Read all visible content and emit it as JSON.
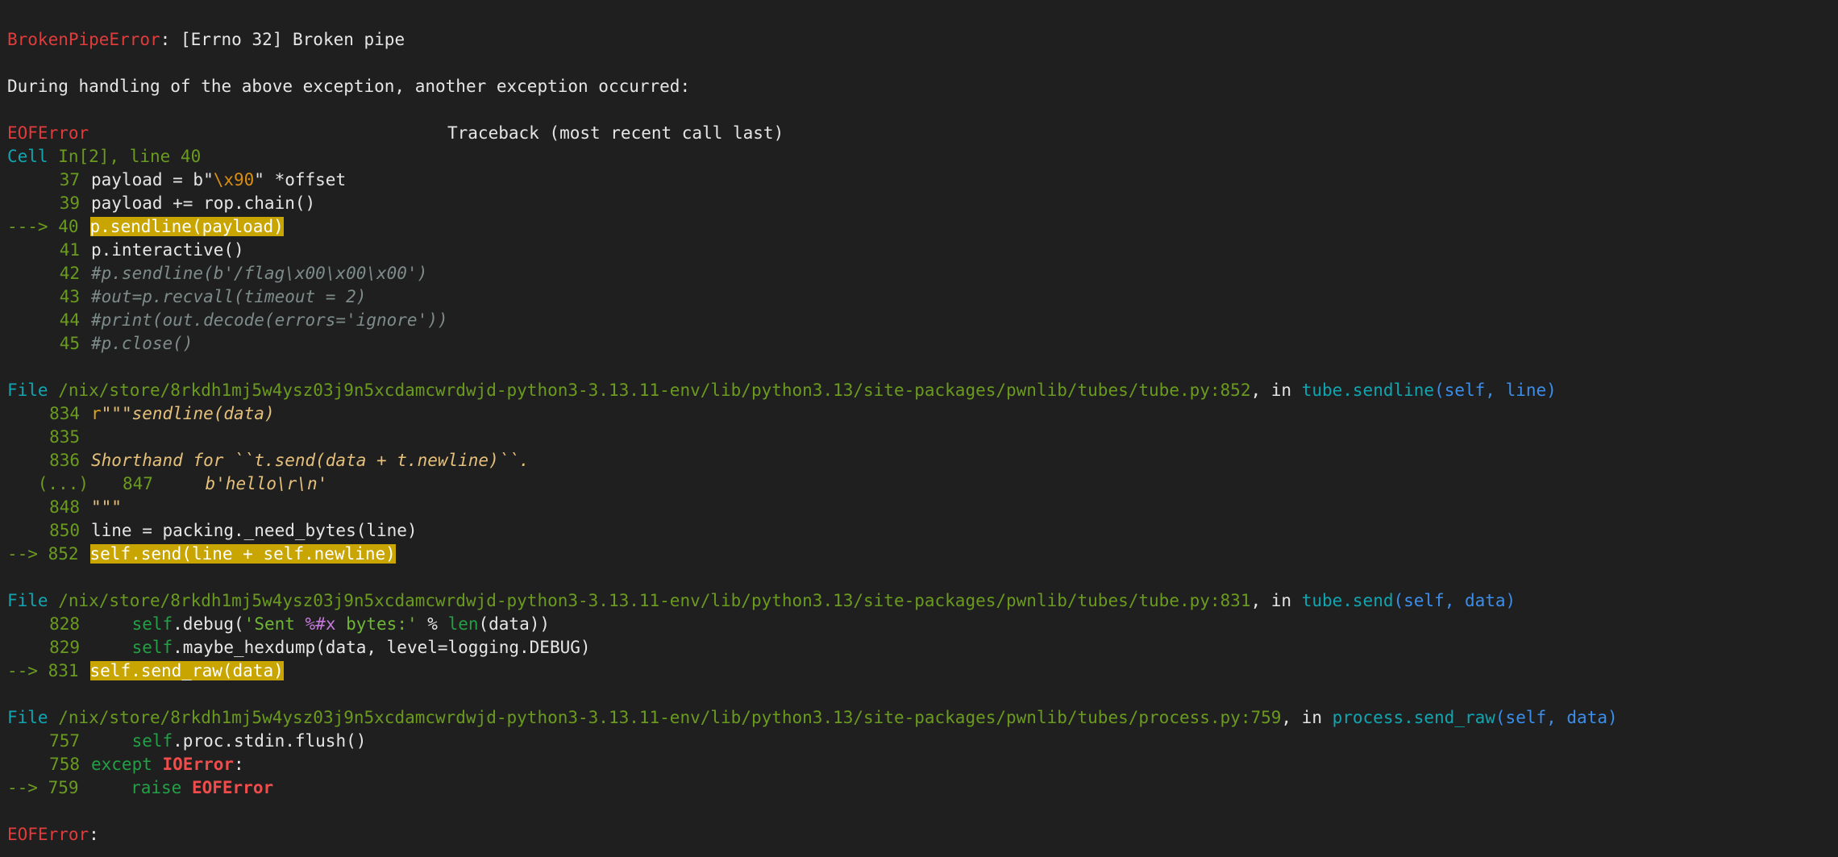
{
  "error1": {
    "name": "BrokenPipeError",
    "message": ": [Errno 32] Broken pipe"
  },
  "during_msg": "During handling of the above exception, another exception occurred:",
  "error2": {
    "name": "EOFError",
    "traceback": "Traceback (most recent call last)"
  },
  "cell": {
    "header": "Cell In[2], line 40",
    "lines": [
      {
        "no": "37",
        "marker": "",
        "text_a": "payload = b\"",
        "text_b": "\\x90",
        "text_c": "\" *offset"
      },
      {
        "no": "39",
        "marker": "",
        "text": "payload += rop.chain()"
      },
      {
        "no": "40",
        "marker": "---> ",
        "text": "p.sendline(payload)"
      },
      {
        "no": "41",
        "marker": "",
        "text": "p.interactive()"
      },
      {
        "no": "42",
        "marker": "",
        "text": "#p.sendline(b'/flag\\x00\\x00\\x00')"
      },
      {
        "no": "43",
        "marker": "",
        "text": "#out=p.recvall(timeout = 2)"
      },
      {
        "no": "44",
        "marker": "",
        "text": "#print(out.decode(errors='ignore'))"
      },
      {
        "no": "45",
        "marker": "",
        "text": "#p.close()"
      }
    ]
  },
  "frame1": {
    "file_label": "File ",
    "path": "/nix/store/8rkdh1mj5w4ysz03j9n5xcdamcwrdwjd-python3-3.13.11-env/lib/python3.13/site-packages/pwnlib/tubes/tube.py:852",
    "in_label": ", in ",
    "func": "tube.sendline",
    "args": "(self, line)",
    "lines": [
      {
        "no": "834",
        "text_a": "r",
        "text_b": "\"\"\"sendline(data)"
      },
      {
        "no": "835",
        "text": ""
      },
      {
        "no": "836",
        "text": "Shorthand for ``t.send(data + t.newline)``."
      },
      {
        "ellipsis": "(...)",
        "no": "847",
        "text": "    b'hello\\r\\n'"
      },
      {
        "no": "848",
        "text": "\"\"\""
      },
      {
        "no": "850",
        "text": "line = packing._need_bytes(line)"
      },
      {
        "no": "852",
        "marker": "--> ",
        "text": "self.send(line + self.newline)"
      }
    ]
  },
  "frame2": {
    "file_label": "File ",
    "path": "/nix/store/8rkdh1mj5w4ysz03j9n5xcdamcwrdwjd-python3-3.13.11-env/lib/python3.13/site-packages/pwnlib/tubes/tube.py:831",
    "in_label": ", in ",
    "func": "tube.send",
    "args": "(self, data)",
    "lines": [
      {
        "no": "828",
        "self": "self",
        "t1": ".debug(",
        "str": "'Sent ",
        "fmt": "%#x",
        "str2": " bytes:'",
        "t2": " % ",
        "builtin": "len",
        "t3": "(data))"
      },
      {
        "no": "829",
        "self": "self",
        "t1": ".maybe_hexdump(data, level=logging.DEBUG)"
      },
      {
        "no": "831",
        "marker": "--> ",
        "text": "self.send_raw(data)"
      }
    ]
  },
  "frame3": {
    "file_label": "File ",
    "path": "/nix/store/8rkdh1mj5w4ysz03j9n5xcdamcwrdwjd-python3-3.13.11-env/lib/python3.13/site-packages/pwnlib/tubes/process.py:759",
    "in_label": ", in ",
    "func": "process.send_raw",
    "args": "(self, data)",
    "lines": [
      {
        "no": "757",
        "self": "self",
        "t1": ".proc.stdin.flush()"
      },
      {
        "no": "758",
        "kw": "except",
        "exc": "IOError",
        "t1": ":"
      },
      {
        "no": "759",
        "marker": "--> ",
        "kw": "raise",
        "exc": "EOFError"
      }
    ]
  },
  "final_error": {
    "name": "EOFError",
    "suffix": ":"
  }
}
